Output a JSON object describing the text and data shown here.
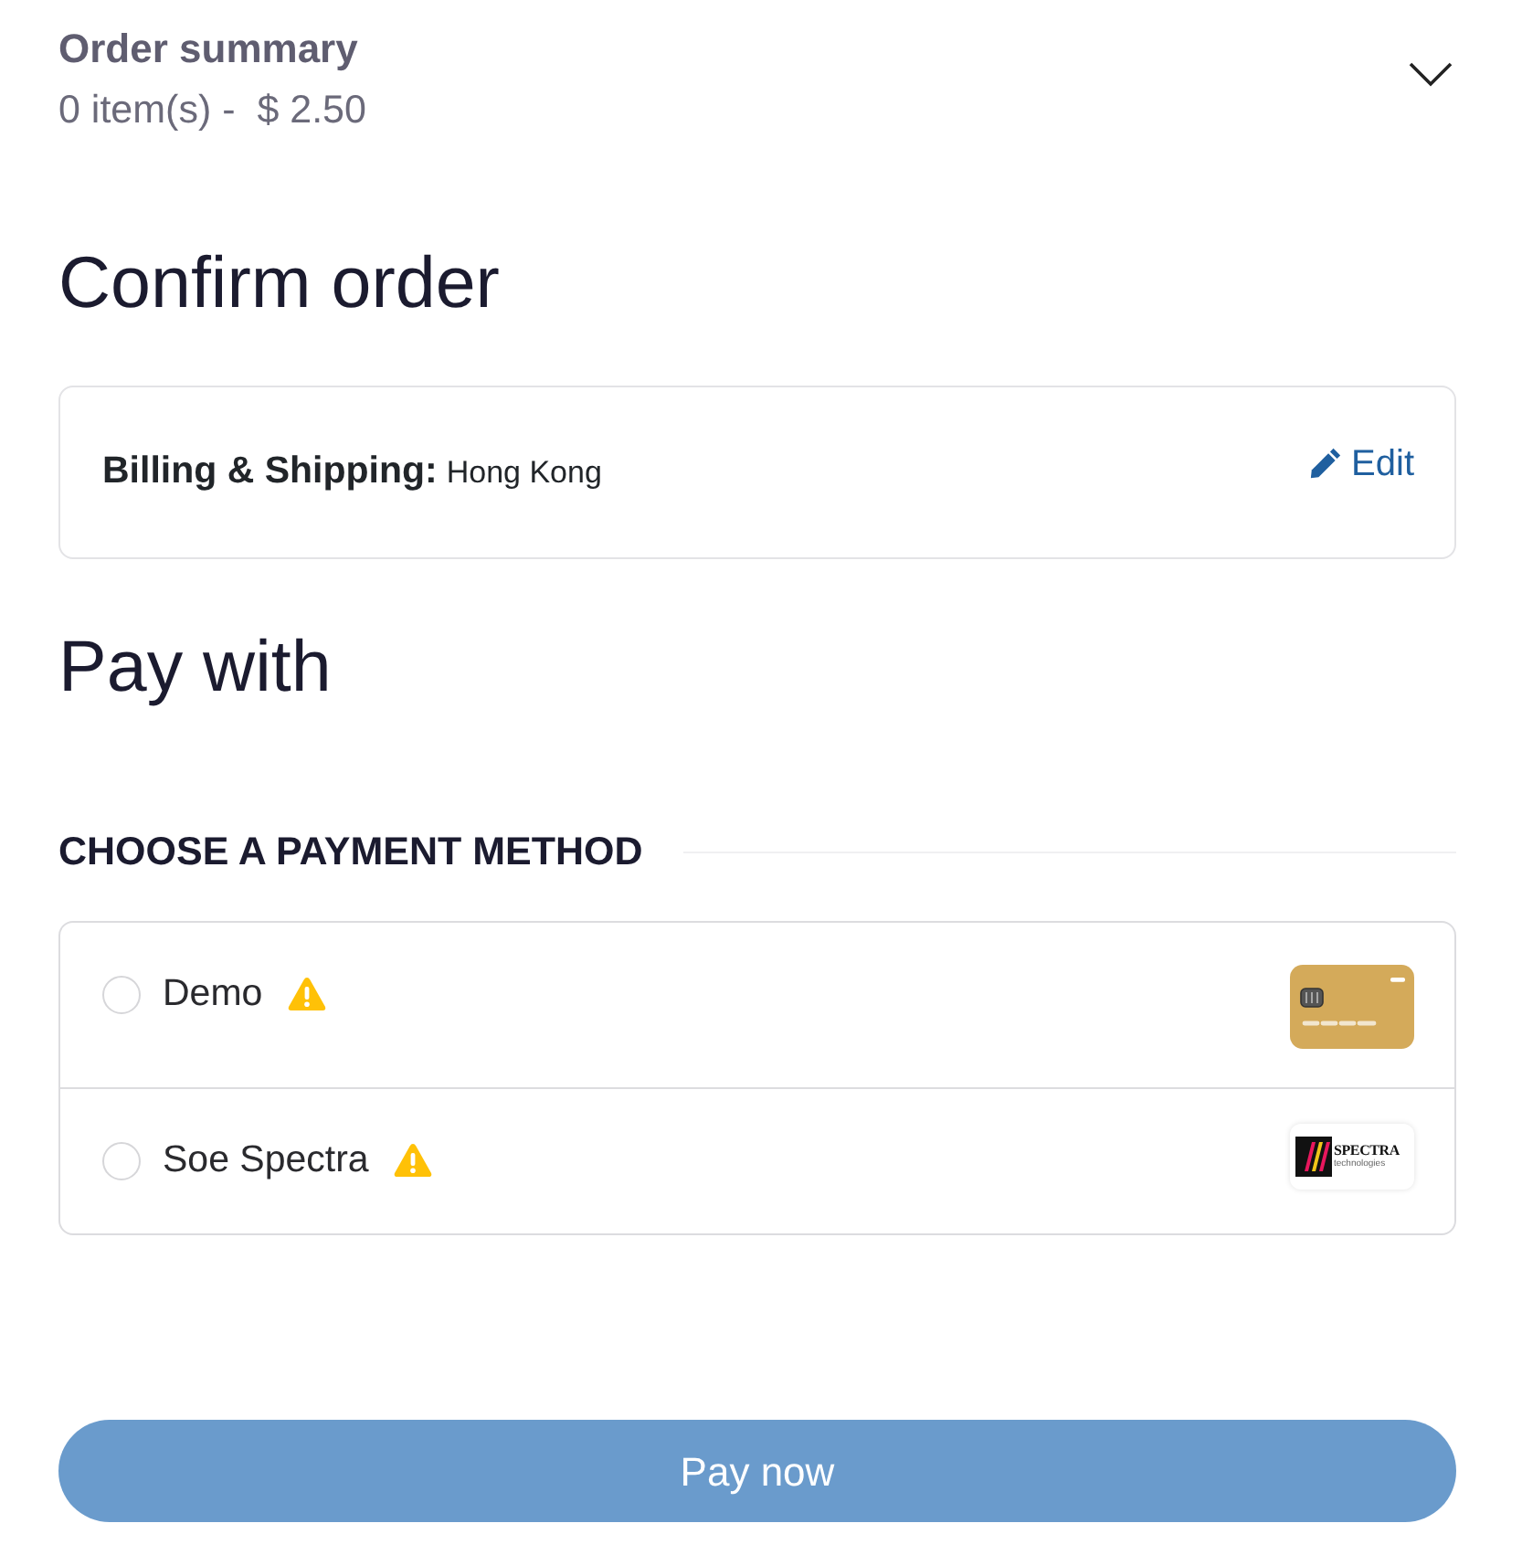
{
  "order_summary": {
    "title": "Order summary",
    "subtitle": "0 item(s) -  $ 2.50",
    "expanded": false
  },
  "confirm": {
    "heading": "Confirm order",
    "billing_label": "Billing & Shipping:",
    "billing_value": "Hong Kong",
    "edit_link": "Edit"
  },
  "pay_with": {
    "heading": "Pay with",
    "section_title": "CHOOSE A PAYMENT METHOD",
    "methods": [
      {
        "name": "Demo",
        "selected": false,
        "warning": true,
        "kind": "card"
      },
      {
        "name": "Soe Spectra",
        "selected": false,
        "warning": true,
        "kind": "spectra",
        "logo_text": "SPECTRA",
        "logo_subtext": "technologies"
      }
    ]
  },
  "pay_button": {
    "label": "Pay now",
    "disabled": true
  }
}
